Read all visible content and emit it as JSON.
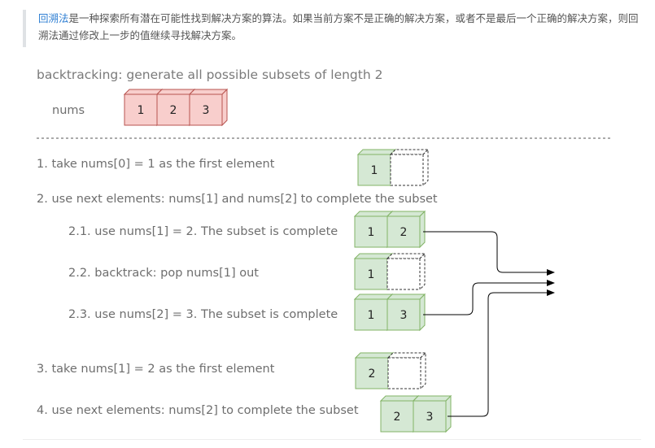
{
  "intro": {
    "term": "回溯法",
    "text": "是一种探索所有潜在可能性找到解决方案的算法。如果当前方案不是正确的解决方案，或者不是最后一个正确的解决方案，则回溯法通过修改上一步的值继续寻找解决方案。"
  },
  "diagram": {
    "title": "backtracking: generate all possible subsets of length 2",
    "nums_label": "nums",
    "nums": [
      "1",
      "2",
      "3"
    ],
    "steps": [
      {
        "text": "1. take nums[0] = 1 as the first element",
        "cells": [
          "1",
          ""
        ]
      },
      {
        "text": "2. use next elements: nums[1] and nums[2] to complete the subset"
      },
      {
        "text": "2.1. use nums[1] = 2. The subset is complete",
        "cells": [
          "1",
          "2"
        ]
      },
      {
        "text": "2.2. backtrack: pop nums[1] out",
        "cells": [
          "1",
          ""
        ]
      },
      {
        "text": "2.3. use nums[2] = 3. The subset is complete",
        "cells": [
          "1",
          "3"
        ]
      },
      {
        "text": "3. take nums[1] = 2 as the first element",
        "cells": [
          "2",
          ""
        ]
      },
      {
        "text": "4. use next elements: nums[2] to complete the subset",
        "cells": [
          "2",
          "3"
        ]
      }
    ],
    "colors": {
      "red_fill": "#f8cecc",
      "red_stroke": "#b85450",
      "green_fill": "#d5e8d4",
      "green_stroke": "#82b366",
      "text": "#6e6e6e",
      "link": "#2f7fd3"
    }
  }
}
